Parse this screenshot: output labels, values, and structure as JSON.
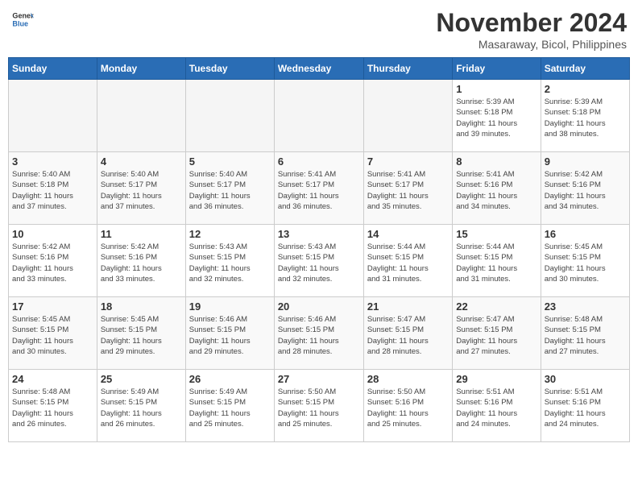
{
  "header": {
    "logo_line1": "General",
    "logo_line2": "Blue",
    "month_title": "November 2024",
    "location": "Masaraway, Bicol, Philippines"
  },
  "weekdays": [
    "Sunday",
    "Monday",
    "Tuesday",
    "Wednesday",
    "Thursday",
    "Friday",
    "Saturday"
  ],
  "weeks": [
    [
      {
        "day": "",
        "info": ""
      },
      {
        "day": "",
        "info": ""
      },
      {
        "day": "",
        "info": ""
      },
      {
        "day": "",
        "info": ""
      },
      {
        "day": "",
        "info": ""
      },
      {
        "day": "1",
        "info": "Sunrise: 5:39 AM\nSunset: 5:18 PM\nDaylight: 11 hours\nand 39 minutes."
      },
      {
        "day": "2",
        "info": "Sunrise: 5:39 AM\nSunset: 5:18 PM\nDaylight: 11 hours\nand 38 minutes."
      }
    ],
    [
      {
        "day": "3",
        "info": "Sunrise: 5:40 AM\nSunset: 5:18 PM\nDaylight: 11 hours\nand 37 minutes."
      },
      {
        "day": "4",
        "info": "Sunrise: 5:40 AM\nSunset: 5:17 PM\nDaylight: 11 hours\nand 37 minutes."
      },
      {
        "day": "5",
        "info": "Sunrise: 5:40 AM\nSunset: 5:17 PM\nDaylight: 11 hours\nand 36 minutes."
      },
      {
        "day": "6",
        "info": "Sunrise: 5:41 AM\nSunset: 5:17 PM\nDaylight: 11 hours\nand 36 minutes."
      },
      {
        "day": "7",
        "info": "Sunrise: 5:41 AM\nSunset: 5:17 PM\nDaylight: 11 hours\nand 35 minutes."
      },
      {
        "day": "8",
        "info": "Sunrise: 5:41 AM\nSunset: 5:16 PM\nDaylight: 11 hours\nand 34 minutes."
      },
      {
        "day": "9",
        "info": "Sunrise: 5:42 AM\nSunset: 5:16 PM\nDaylight: 11 hours\nand 34 minutes."
      }
    ],
    [
      {
        "day": "10",
        "info": "Sunrise: 5:42 AM\nSunset: 5:16 PM\nDaylight: 11 hours\nand 33 minutes."
      },
      {
        "day": "11",
        "info": "Sunrise: 5:42 AM\nSunset: 5:16 PM\nDaylight: 11 hours\nand 33 minutes."
      },
      {
        "day": "12",
        "info": "Sunrise: 5:43 AM\nSunset: 5:15 PM\nDaylight: 11 hours\nand 32 minutes."
      },
      {
        "day": "13",
        "info": "Sunrise: 5:43 AM\nSunset: 5:15 PM\nDaylight: 11 hours\nand 32 minutes."
      },
      {
        "day": "14",
        "info": "Sunrise: 5:44 AM\nSunset: 5:15 PM\nDaylight: 11 hours\nand 31 minutes."
      },
      {
        "day": "15",
        "info": "Sunrise: 5:44 AM\nSunset: 5:15 PM\nDaylight: 11 hours\nand 31 minutes."
      },
      {
        "day": "16",
        "info": "Sunrise: 5:45 AM\nSunset: 5:15 PM\nDaylight: 11 hours\nand 30 minutes."
      }
    ],
    [
      {
        "day": "17",
        "info": "Sunrise: 5:45 AM\nSunset: 5:15 PM\nDaylight: 11 hours\nand 30 minutes."
      },
      {
        "day": "18",
        "info": "Sunrise: 5:45 AM\nSunset: 5:15 PM\nDaylight: 11 hours\nand 29 minutes."
      },
      {
        "day": "19",
        "info": "Sunrise: 5:46 AM\nSunset: 5:15 PM\nDaylight: 11 hours\nand 29 minutes."
      },
      {
        "day": "20",
        "info": "Sunrise: 5:46 AM\nSunset: 5:15 PM\nDaylight: 11 hours\nand 28 minutes."
      },
      {
        "day": "21",
        "info": "Sunrise: 5:47 AM\nSunset: 5:15 PM\nDaylight: 11 hours\nand 28 minutes."
      },
      {
        "day": "22",
        "info": "Sunrise: 5:47 AM\nSunset: 5:15 PM\nDaylight: 11 hours\nand 27 minutes."
      },
      {
        "day": "23",
        "info": "Sunrise: 5:48 AM\nSunset: 5:15 PM\nDaylight: 11 hours\nand 27 minutes."
      }
    ],
    [
      {
        "day": "24",
        "info": "Sunrise: 5:48 AM\nSunset: 5:15 PM\nDaylight: 11 hours\nand 26 minutes."
      },
      {
        "day": "25",
        "info": "Sunrise: 5:49 AM\nSunset: 5:15 PM\nDaylight: 11 hours\nand 26 minutes."
      },
      {
        "day": "26",
        "info": "Sunrise: 5:49 AM\nSunset: 5:15 PM\nDaylight: 11 hours\nand 25 minutes."
      },
      {
        "day": "27",
        "info": "Sunrise: 5:50 AM\nSunset: 5:15 PM\nDaylight: 11 hours\nand 25 minutes."
      },
      {
        "day": "28",
        "info": "Sunrise: 5:50 AM\nSunset: 5:16 PM\nDaylight: 11 hours\nand 25 minutes."
      },
      {
        "day": "29",
        "info": "Sunrise: 5:51 AM\nSunset: 5:16 PM\nDaylight: 11 hours\nand 24 minutes."
      },
      {
        "day": "30",
        "info": "Sunrise: 5:51 AM\nSunset: 5:16 PM\nDaylight: 11 hours\nand 24 minutes."
      }
    ]
  ]
}
